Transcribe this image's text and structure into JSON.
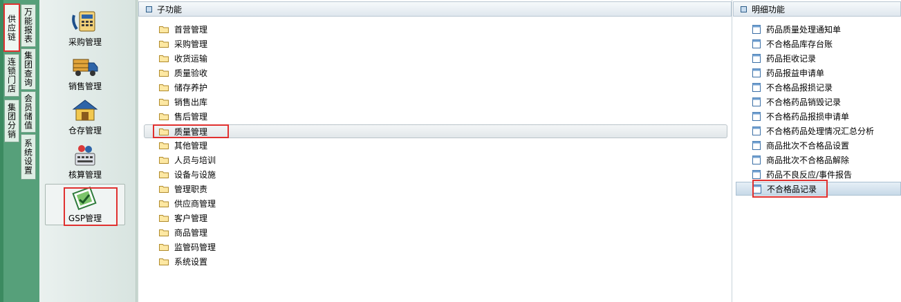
{
  "side_tabs": {
    "left": [
      {
        "label": "供应链",
        "active": true,
        "highlighted": true
      },
      {
        "label": "连锁门店",
        "active": false
      },
      {
        "label": "集团分销",
        "active": false
      }
    ],
    "right": [
      {
        "label": "万能报表"
      },
      {
        "label": "集团查询"
      },
      {
        "label": "会员储值"
      },
      {
        "label": "系统设置"
      }
    ]
  },
  "modules": [
    {
      "label": "采购管理",
      "icon": "purchase-icon"
    },
    {
      "label": "销售管理",
      "icon": "delivery-truck-icon"
    },
    {
      "label": "仓存管理",
      "icon": "warehouse-icon"
    },
    {
      "label": "核算管理",
      "icon": "accounting-icon"
    },
    {
      "label": "GSP管理",
      "icon": "gsp-icon",
      "selected": true
    }
  ],
  "sub_functions": {
    "header": "子功能",
    "items": [
      "首营管理",
      "采购管理",
      "收货运输",
      "质量验收",
      "储存养护",
      "销售出库",
      "售后管理",
      "质量管理",
      "其他管理",
      "人员与培训",
      "设备与设施",
      "管理职责",
      "供应商管理",
      "客户管理",
      "商品管理",
      "监管码管理",
      "系统设置"
    ],
    "selected": "质量管理"
  },
  "detail_functions": {
    "header": "明细功能",
    "items": [
      "药品质量处理通知单",
      "不合格品库存台账",
      "药品拒收记录",
      "药品报益申请单",
      "不合格品报损记录",
      "不合格药品销毁记录",
      "不合格药品报损申请单",
      "不合格药品处理情况汇总分析",
      "商品批次不合格品设置",
      "商品批次不合格品解除",
      "药品不良反应/事件报告",
      "不合格品记录"
    ],
    "selected": "不合格品记录"
  },
  "colors": {
    "rail_green": "#56a07a",
    "highlight_red": "#e0302f",
    "header_blue": "#2b5b86"
  }
}
